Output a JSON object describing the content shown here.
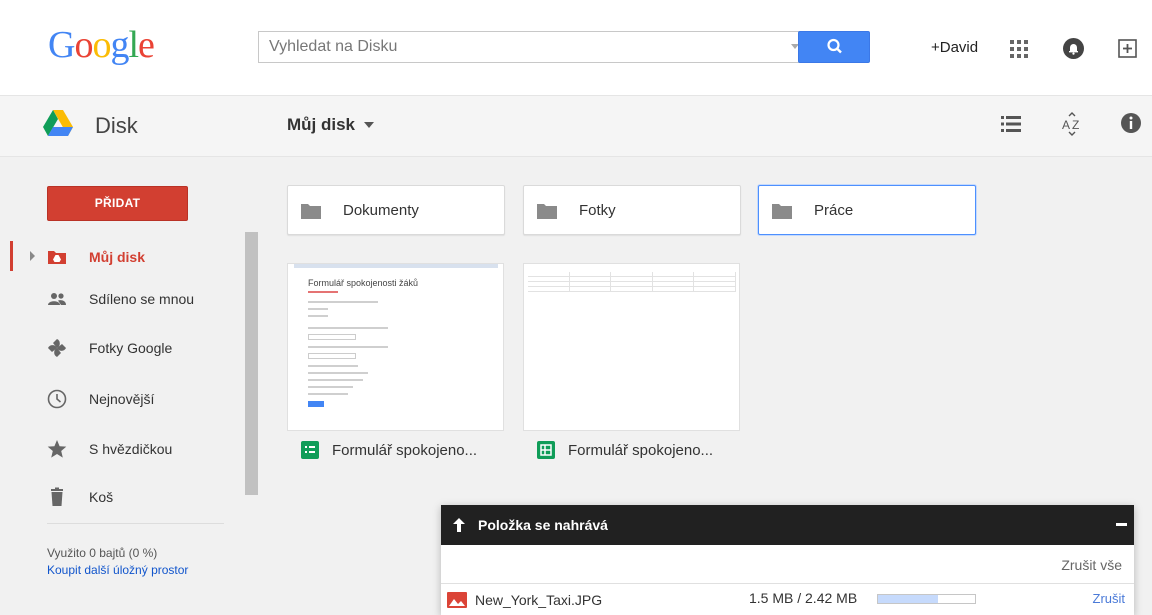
{
  "header": {
    "logo_letters": [
      {
        "ch": "G",
        "color": "#4285f4"
      },
      {
        "ch": "o",
        "color": "#ea4335"
      },
      {
        "ch": "o",
        "color": "#fbbc05"
      },
      {
        "ch": "g",
        "color": "#4285f4"
      },
      {
        "ch": "l",
        "color": "#34a853"
      },
      {
        "ch": "e",
        "color": "#ea4335"
      }
    ],
    "search_placeholder": "Vyhledat na Disku",
    "user_label": "+David",
    "icons": [
      "search-icon",
      "apps-icon",
      "notifications-icon",
      "share-icon"
    ]
  },
  "toolbar": {
    "app_title": "Disk",
    "breadcrumb": "Můj disk",
    "icons": [
      "list-view-icon",
      "sort-icon",
      "info-icon"
    ]
  },
  "sidebar": {
    "add_button": "PŘIDAT",
    "items": [
      {
        "label": "Můj disk",
        "icon": "my-drive-icon",
        "active": true
      },
      {
        "label": "Sdíleno se mnou",
        "icon": "shared-icon",
        "active": false
      },
      {
        "label": "Fotky Google",
        "icon": "photos-icon",
        "active": false
      },
      {
        "label": "Nejnovější",
        "icon": "clock-icon",
        "active": false
      },
      {
        "label": "S hvězdičkou",
        "icon": "star-icon",
        "active": false
      },
      {
        "label": "Koš",
        "icon": "trash-icon",
        "active": false
      }
    ],
    "usage": "Využito 0 bajtů (0 %)",
    "upgrade_link": "Koupit další úložný prostor"
  },
  "main": {
    "folders": [
      {
        "name": "Dokumenty",
        "selected": false
      },
      {
        "name": "Fotky",
        "selected": false
      },
      {
        "name": "Práce",
        "selected": true
      }
    ],
    "files": [
      {
        "name": "Formulář spokojeno...",
        "type": "forms",
        "icon": "forms-icon",
        "thumb_title": "Formulář spokojenosti žáků"
      },
      {
        "name": "Formulář spokojeno...",
        "type": "sheets",
        "icon": "sheets-icon"
      }
    ]
  },
  "upload": {
    "title": "Položka se nahrává",
    "cancel_all": "Zrušit vše",
    "item": {
      "name": "New_York_Taxi.JPG",
      "size": "1.5 MB / 2.42 MB",
      "progress": 0.62,
      "cancel": "Zrušit"
    }
  },
  "colors": {
    "accent_red": "#d23f31",
    "blue": "#4285f4",
    "forms_green": "#0f9d58",
    "sheets_green": "#0f9d58"
  }
}
